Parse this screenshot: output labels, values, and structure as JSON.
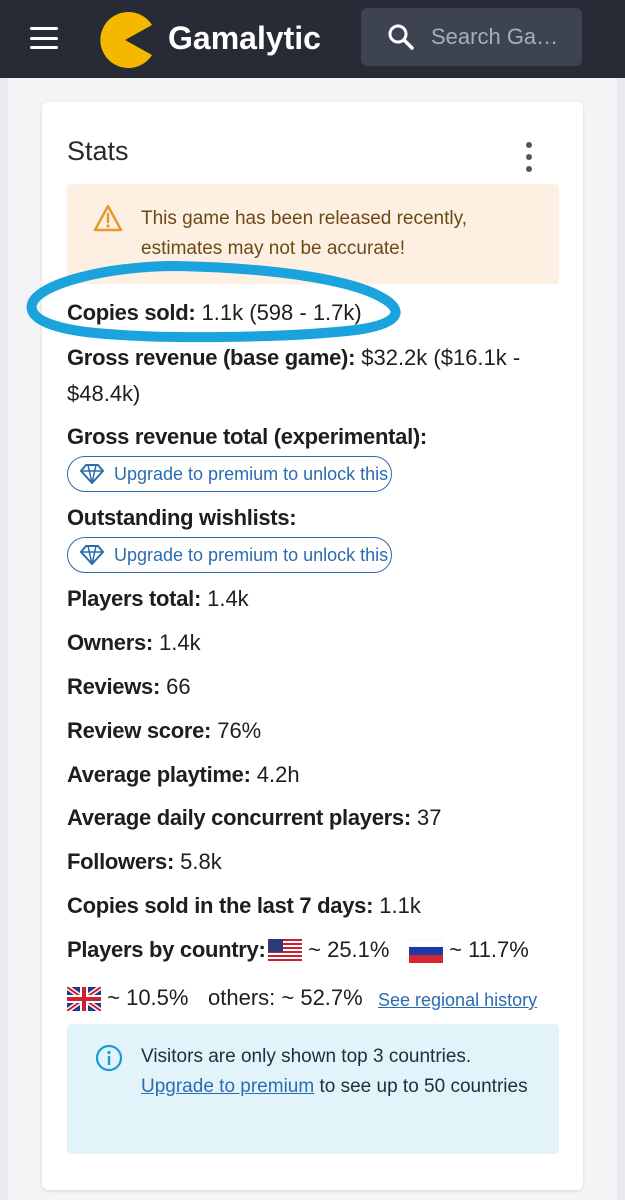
{
  "header": {
    "brand": "Gamalytic",
    "search_placeholder": "Search Gam..."
  },
  "card": {
    "title": "Stats",
    "warning": "This game has been released recently, estimates may not be accurate!"
  },
  "stats": {
    "copies_sold": {
      "label": "Copies sold:",
      "value": "1.1k (598 - 1.7k)"
    },
    "gross_revenue": {
      "label": "Gross revenue (base game):",
      "value_line1": "$32.2k ($16.1k -",
      "value_line2": "$48.4k)"
    },
    "gross_total": {
      "label": "Gross revenue total (experimental):"
    },
    "wishlists": {
      "label": "Outstanding wishlists:"
    },
    "premium_label": "Upgrade to premium to unlock this",
    "players_total": {
      "label": "Players total:",
      "value": "1.4k"
    },
    "owners": {
      "label": "Owners:",
      "value": "1.4k"
    },
    "reviews": {
      "label": "Reviews:",
      "value": "66"
    },
    "review_score": {
      "label": "Review score:",
      "value": "76%"
    },
    "avg_playtime": {
      "label": "Average playtime:",
      "value": "4.2h"
    },
    "avg_concurrent": {
      "label": "Average daily concurrent players:",
      "value": "37"
    },
    "followers": {
      "label": "Followers:",
      "value": "5.8k"
    },
    "copies_7d": {
      "label": "Copies sold in the last 7 days:",
      "value": "1.1k"
    },
    "players_by_country": {
      "label": "Players by country:",
      "us": "~ 25.1%",
      "ru": "~ 11.7%",
      "uk": "~ 10.5%",
      "others": "others: ~ 52.7%",
      "regional_link": "See regional history"
    }
  },
  "info": {
    "text_before": "Visitors are only shown top 3 countries.",
    "link": "Upgrade to premium",
    "text_after": "to see up to 50 countries"
  },
  "icons": {
    "menu": "hamburger-menu-icon",
    "logo": "pacman-logo-icon",
    "search": "search-icon",
    "more": "kebab-more-icon",
    "warning": "warning-triangle-icon",
    "premium": "diamond-icon",
    "info": "info-circle-icon"
  },
  "colors": {
    "topbar": "#262b36",
    "logo": "#f5b800",
    "accent_link": "#2b6cb0",
    "highlight_marker": "#1aa3dc",
    "warning_bg": "#fdf0e2",
    "info_bg": "#e3f3fa"
  }
}
